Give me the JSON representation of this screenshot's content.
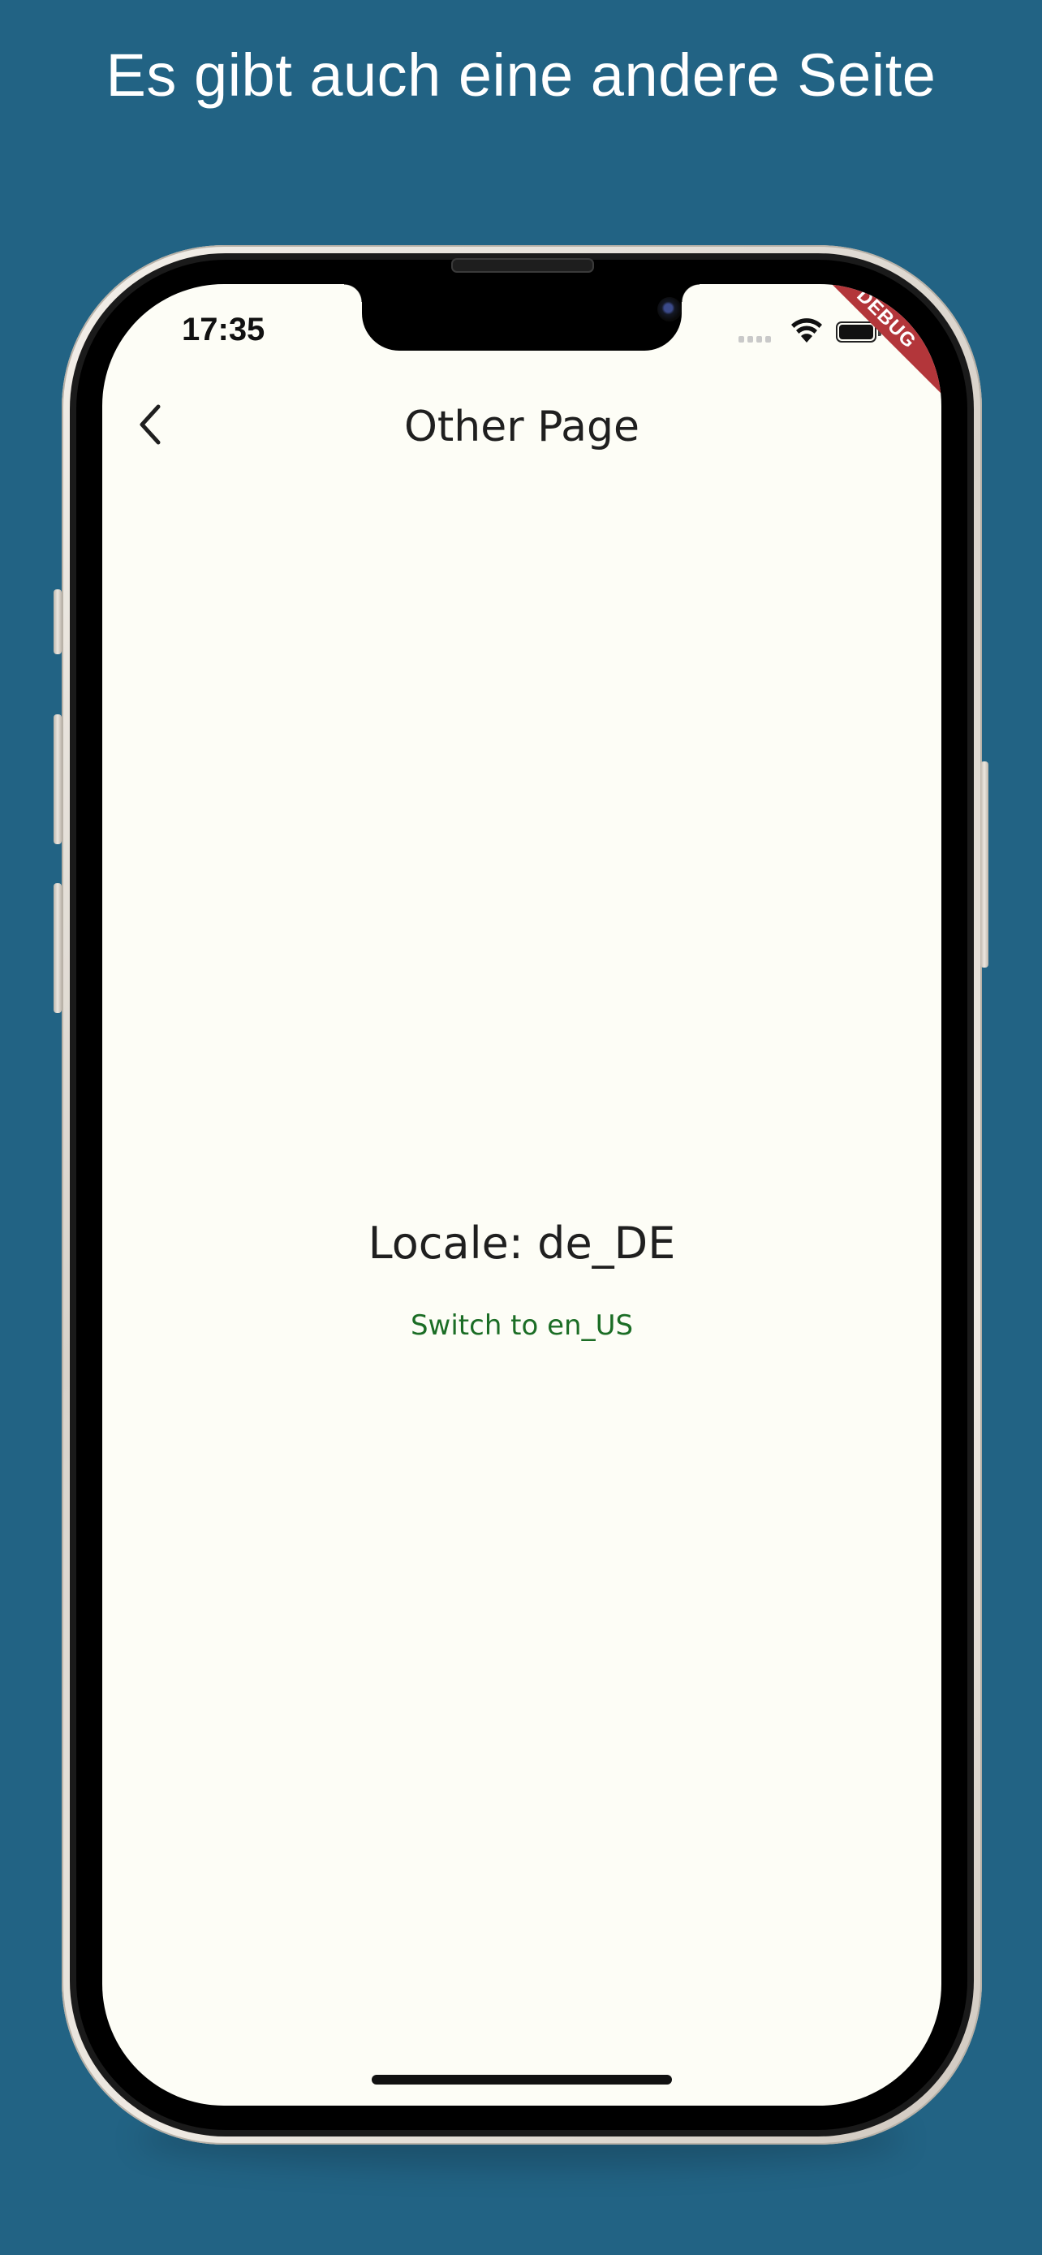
{
  "headline": "Es gibt auch eine andere Seite",
  "status_bar": {
    "time": "17:35",
    "debug_banner": "DEBUG"
  },
  "app_bar": {
    "title": "Other Page",
    "back_icon": "chevron-left-icon"
  },
  "content": {
    "locale_label": "Locale: de_DE",
    "switch_button_label": "Switch to en_US"
  },
  "colors": {
    "background": "#226384",
    "screen": "#fdfdf6",
    "accent_text": "#1b6d25",
    "debug_ribbon": "#b3363a"
  }
}
